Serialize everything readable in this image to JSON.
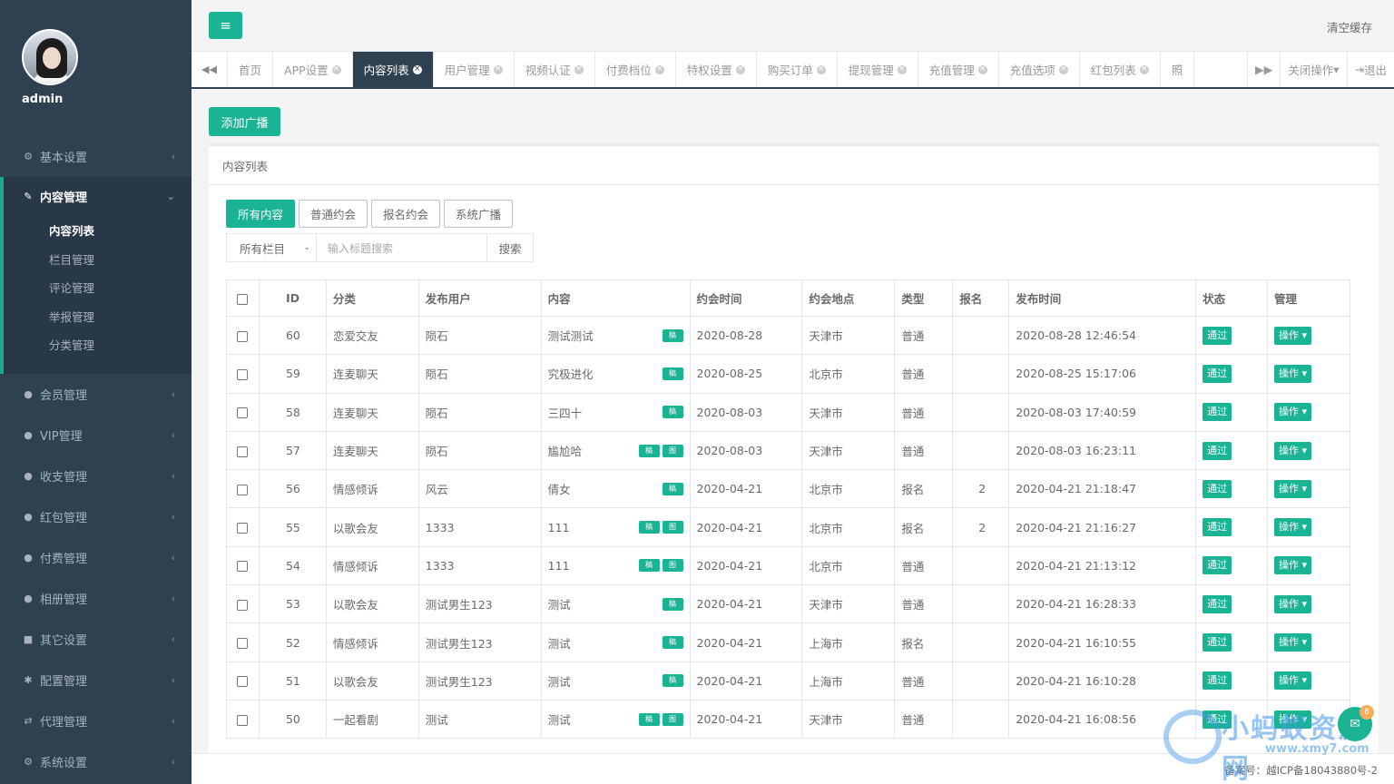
{
  "sidebar": {
    "username": "admin",
    "menu": [
      {
        "icon": "gear-icon",
        "glyph": "⚙",
        "label": "基本设置"
      },
      {
        "icon": "edit-icon",
        "glyph": "✎",
        "label": "内容管理"
      },
      {
        "icon": "user-icon",
        "glyph": "●",
        "label": "会员管理"
      },
      {
        "icon": "user-icon",
        "glyph": "●",
        "label": "VIP管理"
      },
      {
        "icon": "user-icon",
        "glyph": "●",
        "label": "收支管理"
      },
      {
        "icon": "user-icon",
        "glyph": "●",
        "label": "红包管理"
      },
      {
        "icon": "user-icon",
        "glyph": "●",
        "label": "付费管理"
      },
      {
        "icon": "user-icon",
        "glyph": "●",
        "label": "相册管理"
      },
      {
        "icon": "book-icon",
        "glyph": "■",
        "label": "其它设置"
      },
      {
        "icon": "asterisk-icon",
        "glyph": "✱",
        "label": "配置管理"
      },
      {
        "icon": "exchange-icon",
        "glyph": "⇄",
        "label": "代理管理"
      },
      {
        "icon": "cogs-icon",
        "glyph": "⚙",
        "label": "系统设置"
      }
    ],
    "submenu": [
      "内容列表",
      "栏目管理",
      "评论管理",
      "举报管理",
      "分类管理"
    ]
  },
  "topbar": {
    "menu_glyph": "≡",
    "clear_cache": "清空缓存"
  },
  "tabs": {
    "prev_glyph": "◀◀",
    "next_glyph": "▶▶",
    "items": [
      "首页",
      "APP设置",
      "内容列表",
      "用户管理",
      "视频认证",
      "付费档位",
      "特权设置",
      "购买订单",
      "提现管理",
      "充值管理",
      "充值选项",
      "红包列表",
      "照"
    ],
    "close_ops": "关闭操作",
    "logout": "退出"
  },
  "content": {
    "add_button": "添加广播",
    "panel_title": "内容列表",
    "filters": [
      "所有内容",
      "普通约会",
      "报名约会",
      "系统广播"
    ],
    "category_select": "所有栏目",
    "search_placeholder": "输入标题搜索",
    "search_button": "搜索"
  },
  "table": {
    "headers": [
      "ID",
      "分类",
      "发布用户",
      "内容",
      "约会时间",
      "约会地点",
      "类型",
      "报名",
      "发布时间",
      "状态",
      "管理"
    ],
    "tag_video": "稿",
    "tag_image": "图",
    "status_label": "通过",
    "op_label": "操作",
    "rows": [
      {
        "id": "60",
        "cat": "恋爱交友",
        "user": "陨石",
        "content": "测试测试",
        "img": false,
        "date": "2020-08-28",
        "place": "天津市",
        "type": "普通",
        "signup": "",
        "pub": "2020-08-28 12:46:54"
      },
      {
        "id": "59",
        "cat": "连麦聊天",
        "user": "陨石",
        "content": "究极进化",
        "img": false,
        "date": "2020-08-25",
        "place": "北京市",
        "type": "普通",
        "signup": "",
        "pub": "2020-08-25 15:17:06"
      },
      {
        "id": "58",
        "cat": "连麦聊天",
        "user": "陨石",
        "content": "三四十",
        "img": false,
        "date": "2020-08-03",
        "place": "天津市",
        "type": "普通",
        "signup": "",
        "pub": "2020-08-03 17:40:59"
      },
      {
        "id": "57",
        "cat": "连麦聊天",
        "user": "陨石",
        "content": "尴尬哈",
        "img": true,
        "date": "2020-08-03",
        "place": "天津市",
        "type": "普通",
        "signup": "",
        "pub": "2020-08-03 16:23:11"
      },
      {
        "id": "56",
        "cat": "情感倾诉",
        "user": "风云",
        "content": "倩女",
        "img": false,
        "date": "2020-04-21",
        "place": "北京市",
        "type": "报名",
        "signup": "2",
        "pub": "2020-04-21 21:18:47"
      },
      {
        "id": "55",
        "cat": "以歌会友",
        "user": "1333",
        "content": "111",
        "img": true,
        "date": "2020-04-21",
        "place": "北京市",
        "type": "报名",
        "signup": "2",
        "pub": "2020-04-21 21:16:27"
      },
      {
        "id": "54",
        "cat": "情感倾诉",
        "user": "1333",
        "content": "111",
        "img": true,
        "date": "2020-04-21",
        "place": "北京市",
        "type": "普通",
        "signup": "",
        "pub": "2020-04-21 21:13:12"
      },
      {
        "id": "53",
        "cat": "以歌会友",
        "user": "测试男生123",
        "content": "测试",
        "img": false,
        "date": "2020-04-21",
        "place": "天津市",
        "type": "普通",
        "signup": "",
        "pub": "2020-04-21 16:28:33"
      },
      {
        "id": "52",
        "cat": "情感倾诉",
        "user": "测试男生123",
        "content": "测试",
        "img": false,
        "date": "2020-04-21",
        "place": "上海市",
        "type": "报名",
        "signup": "",
        "pub": "2020-04-21 16:10:55"
      },
      {
        "id": "51",
        "cat": "以歌会友",
        "user": "测试男生123",
        "content": "测试",
        "img": false,
        "date": "2020-04-21",
        "place": "上海市",
        "type": "普通",
        "signup": "",
        "pub": "2020-04-21 16:10:28"
      },
      {
        "id": "50",
        "cat": "一起看剧",
        "user": "测试",
        "content": "测试",
        "img": true,
        "date": "2020-04-21",
        "place": "天津市",
        "type": "普通",
        "signup": "",
        "pub": "2020-04-21 16:08:56"
      }
    ]
  },
  "footer": {
    "icp": "备案号：越ICP备18043880号-2",
    "watermark": "小蚂蚁资源网",
    "watermark_url": "www.xmy7.com",
    "chat_badge": "8"
  },
  "colors": {
    "sidebar_bg": "#2f4050",
    "accent": "#1ab394"
  }
}
